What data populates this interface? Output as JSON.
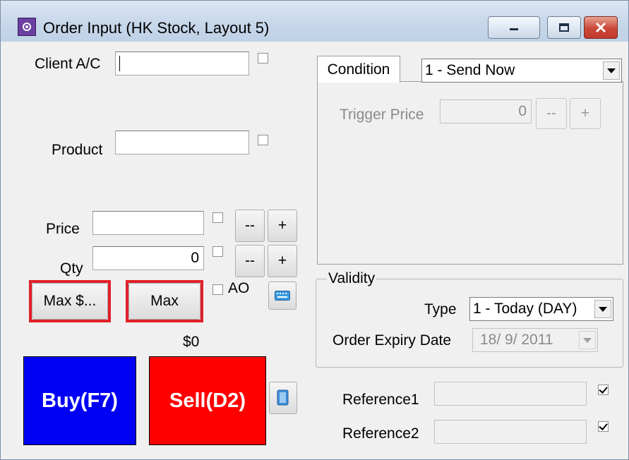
{
  "window": {
    "title": "Order Input (HK Stock, Layout 5)",
    "icons": [
      "app-icon",
      "minimize-icon",
      "maximize-icon",
      "close-icon"
    ]
  },
  "left": {
    "client_label": "Client A/C",
    "client_value": "",
    "product_label": "Product",
    "product_value": "",
    "price_label": "Price",
    "price_value": "",
    "qty_label": "Qty",
    "qty_value": "0",
    "minus_label": "--",
    "plus_label": "+",
    "max_dollar_label": "Max $...",
    "max_label": "Max",
    "ao_label": "AO",
    "amount": "$0",
    "buy_label": "Buy(F7)",
    "sell_label": "Sell(D2)"
  },
  "condition": {
    "tab_label": "Condition",
    "selected": "1 - Send Now",
    "trigger_label": "Trigger Price",
    "trigger_value": "0",
    "minus_label": "--",
    "plus_label": "+"
  },
  "validity": {
    "group_label": "Validity",
    "type_label": "Type",
    "type_selected": "1 - Today (DAY)",
    "expiry_label": "Order Expiry Date",
    "expiry_value": "18/  9/ 2011"
  },
  "references": {
    "ref1_label": "Reference1",
    "ref1_value": "",
    "ref1_checked": true,
    "ref2_label": "Reference2",
    "ref2_value": "",
    "ref2_checked": true
  },
  "colors": {
    "buy": "#0000f5",
    "sell": "#ff0000",
    "highlight": "#e0202a"
  }
}
